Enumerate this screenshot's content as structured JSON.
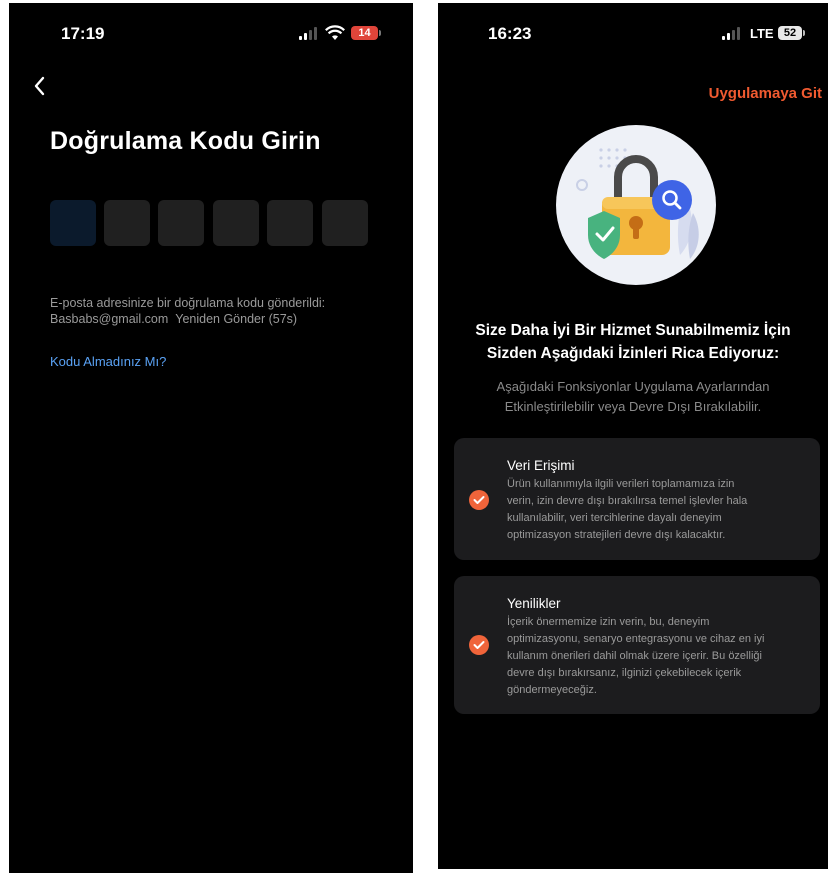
{
  "left_screen": {
    "status_bar": {
      "time": "17:19",
      "battery": "14"
    },
    "title": "Doğrulama Kodu Girin",
    "code_fields": [
      "",
      "",
      "",
      "",
      "",
      ""
    ],
    "info_line1": "E-posta adresinize bir doğrulama kodu gönderildi:",
    "email": "Basbabs@gmail.com",
    "resend": "Yeniden Gönder (57s)",
    "no_code_link": "Kodu Almadınız Mı?",
    "colors": {
      "link": "#5aa2f5",
      "battery_low": "#e0453a"
    }
  },
  "right_screen": {
    "status_bar": {
      "time": "16:23",
      "network": "LTE",
      "battery": "52"
    },
    "goto_app": "Uygulamaya Git",
    "illustration_icons": [
      "padlock-icon",
      "shield-check-icon",
      "magnifier-icon"
    ],
    "heading_line1": "Size Daha İyi Bir Hizmet Sunabilmemiz İçin",
    "heading_line2": "Sizden Aşağıdaki İzinleri Rica Ediyoruz:",
    "sub_line1": "Aşağıdaki Fonksiyonlar Uygulama Ayarlarından",
    "sub_line2": "Etkinleştirilebilir  veya Devre Dışı Bırakılabilir.",
    "permissions": [
      {
        "title": "Veri Erişimi",
        "lines": [
          "Ürün kullanımıyla ilgili verileri toplamamıza izin",
          "verin, izin devre dışı bırakılırsa temel işlevler hala",
          "kullanılabilir, veri tercihlerine dayalı deneyim",
          "optimizasyon stratejileri devre dışı kalacaktır."
        ],
        "checked": true
      },
      {
        "title": "Yenilikler",
        "lines": [
          "İçerik önermemize izin verin, bu, deneyim",
          "optimizasyonu, senaryo entegrasyonu ve cihaz en iyi",
          "kullanım önerileri dahil olmak üzere içerir. Bu özelliği",
          "devre dışı bırakırsanız, ilginizi çekebilecek içerik",
          "göndermeyeceğiz."
        ],
        "checked": true
      }
    ],
    "colors": {
      "accent": "#f05a30",
      "card_bg": "#1c1c1e"
    }
  }
}
